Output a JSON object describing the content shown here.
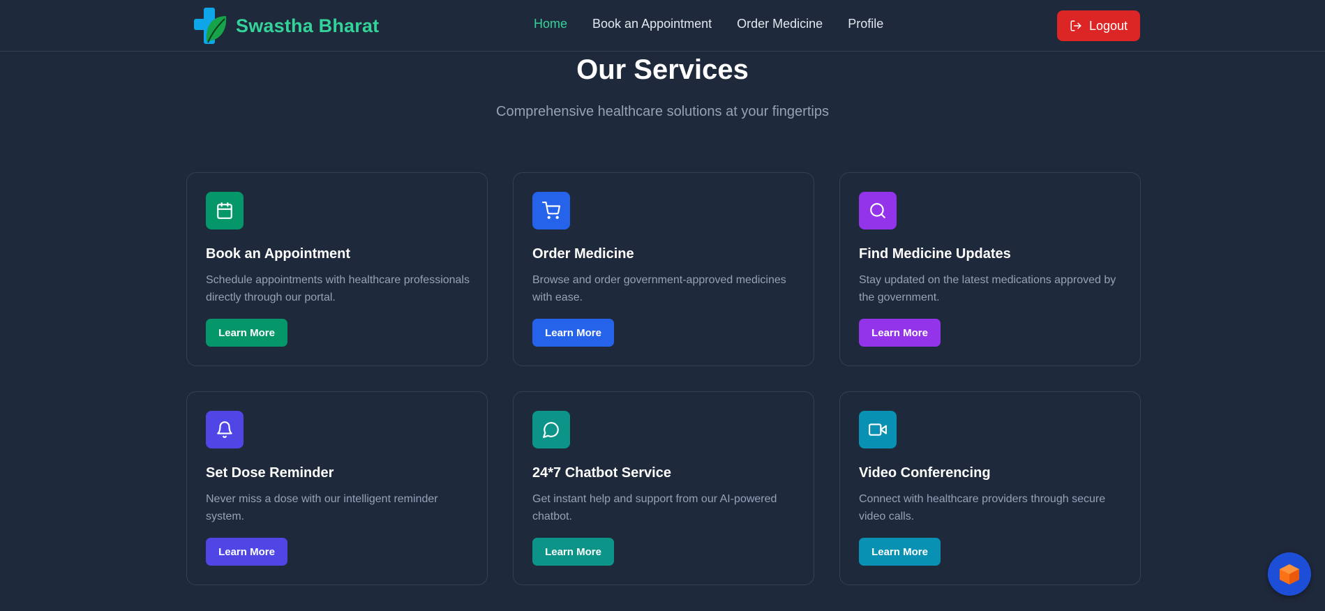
{
  "brand": {
    "name": "Swastha Bharat"
  },
  "nav": {
    "links": [
      {
        "label": "Home",
        "active": true
      },
      {
        "label": "Book an Appointment",
        "active": false
      },
      {
        "label": "Order Medicine",
        "active": false
      },
      {
        "label": "Profile",
        "active": false
      }
    ],
    "logout_label": "Logout"
  },
  "services": {
    "title": "Our Services",
    "subtitle": "Comprehensive healthcare solutions at your fingertips",
    "cards": [
      {
        "icon": "calendar-icon",
        "title": "Book an Appointment",
        "description": "Schedule appointments with healthcare professionals directly through our portal.",
        "button": "Learn More",
        "color": "#059669"
      },
      {
        "icon": "cart-icon",
        "title": "Order Medicine",
        "description": "Browse and order government-approved medicines with ease.",
        "button": "Learn More",
        "color": "#2563eb"
      },
      {
        "icon": "search-icon",
        "title": "Find Medicine Updates",
        "description": "Stay updated on the latest medications approved by the government.",
        "button": "Learn More",
        "color": "#9333ea"
      },
      {
        "icon": "bell-icon",
        "title": "Set Dose Reminder",
        "description": "Never miss a dose with our intelligent reminder system.",
        "button": "Learn More",
        "color": "#4f46e5"
      },
      {
        "icon": "chat-bubble-icon",
        "title": "24*7 Chatbot Service",
        "description": "Get instant help and support from our AI-powered chatbot.",
        "button": "Learn More",
        "color": "#0d9488"
      },
      {
        "icon": "video-camera-icon",
        "title": "Video Conferencing",
        "description": "Connect with healthcare providers through secure video calls.",
        "button": "Learn More",
        "color": "#0891b2"
      }
    ]
  },
  "colors": {
    "background": "#1e293b",
    "accent": "#34d399",
    "logout": "#dc2626",
    "muted_text": "#94a3b8"
  }
}
